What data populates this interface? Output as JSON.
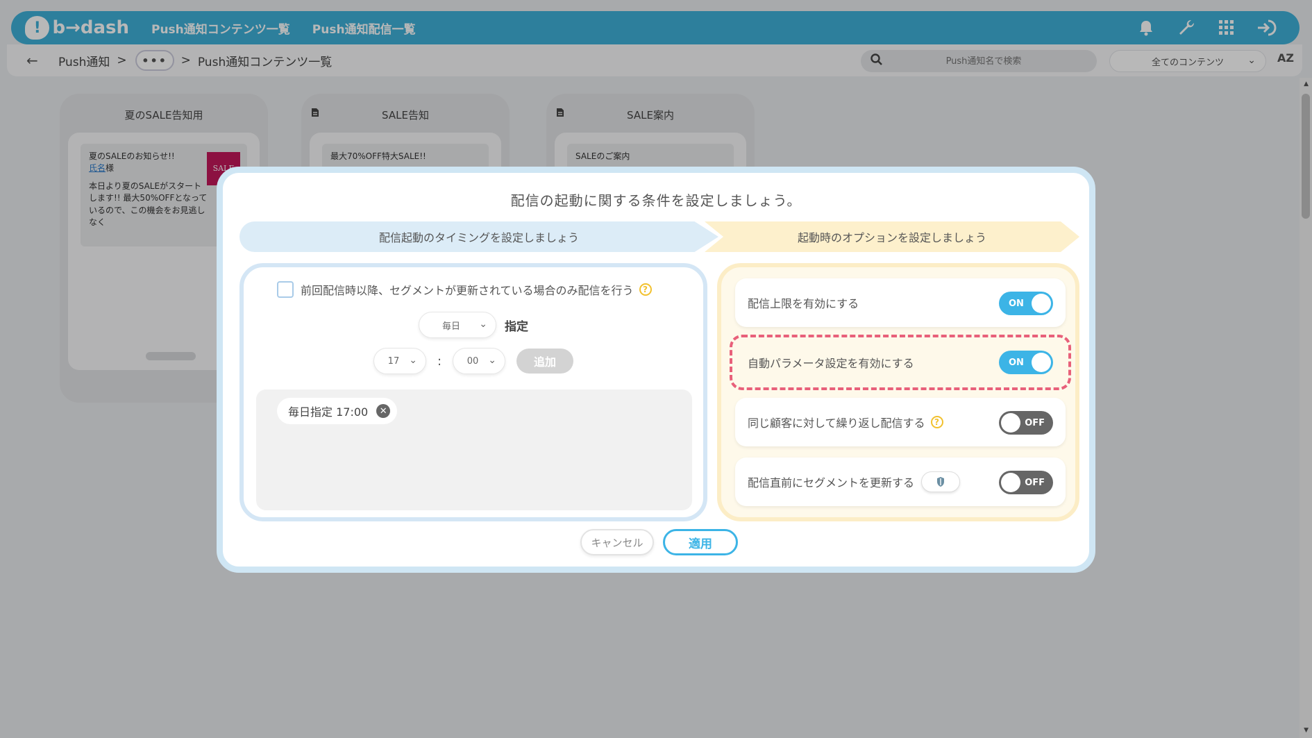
{
  "app": {
    "logo_mark": "!",
    "logo_text": "b→dash",
    "nav": [
      "Push通知コンテンツ一覧",
      "Push通知配信一覧"
    ],
    "icons": [
      "bell-icon",
      "wrench-icon",
      "apps-grid-icon",
      "sign-in-icon"
    ]
  },
  "subbar": {
    "back": "←",
    "crumb_root": "Push通知",
    "crumb_sep": ">",
    "crumb_more": "•••",
    "crumb_current": "Push通知コンテンツ一覧",
    "search_placeholder": "Push通知名で検索",
    "filter_value": "全てのコンテンツ",
    "sort_label": "AZ"
  },
  "cards": [
    {
      "title": "夏のSALE告知用",
      "has_doc_icon": false,
      "notif_title": "夏のSALEのお知らせ!!",
      "name_link": "氏名",
      "name_suffix": "様",
      "notif_body": "本日より夏のSALEがスタートします!! 最大50%OFFとなっているので、この機会をお見逃しなく",
      "thumb_text": "SALE"
    },
    {
      "title": "SALE告知",
      "has_doc_icon": true,
      "notif_title": "最大70%OFF特大SALE!!"
    },
    {
      "title": "SALE案内",
      "has_doc_icon": true,
      "notif_title": "SALEのご案内"
    }
  ],
  "modal": {
    "title": "配信の起動に関する条件を設定しましょう。",
    "step1": "配信起動のタイミングを設定しましょう",
    "step2": "起動時のオプションを設定しましょう",
    "segment_condition_label": "前回配信時以降、セグメントが更新されている場合のみ配信を行う",
    "frequency_value": "毎日",
    "frequency_suffix": "指定",
    "hour_value": "17",
    "time_colon": ":",
    "minute_value": "00",
    "add_label": "追加",
    "schedules": [
      "毎日指定 17:00"
    ],
    "options": [
      {
        "label": "配信上限を有効にする",
        "state": "ON",
        "help": false
      },
      {
        "label": "自動パラメータ設定を有効にする",
        "state": "ON",
        "help": false,
        "highlighted": true
      },
      {
        "label": "同じ顧客に対して繰り返し配信する",
        "state": "OFF",
        "help": true
      },
      {
        "label": "配信直前にセグメントを更新する",
        "state": "OFF",
        "help": false,
        "shield": true
      }
    ],
    "cancel_label": "キャンセル",
    "apply_label": "適用"
  },
  "colors": {
    "accent": "#3cb4e6",
    "topbar": "#3fb1d9",
    "highlight": "#e8607a",
    "help": "#f2c12e"
  }
}
